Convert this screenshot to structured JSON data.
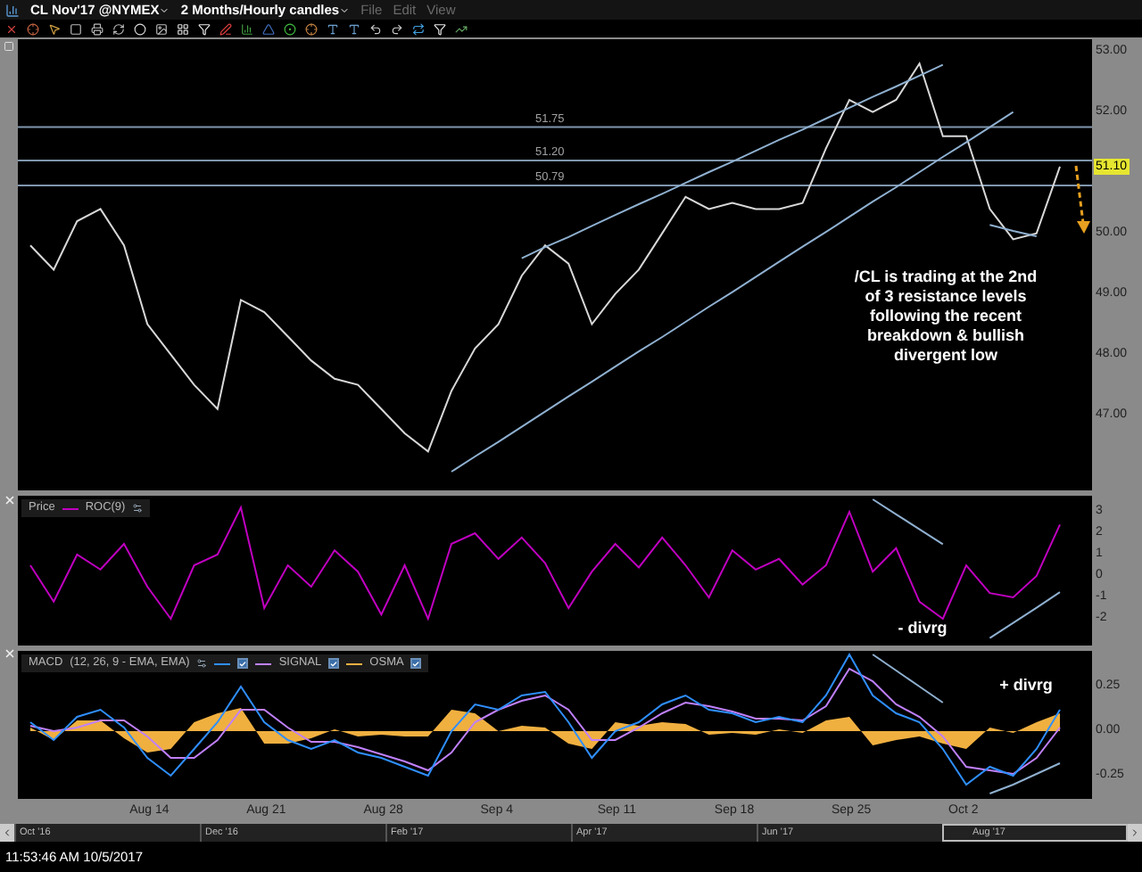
{
  "title_bar": {
    "symbol": "CL Nov'17 @NYMEX",
    "timeframe": "2 Months/Hourly candles",
    "menus": [
      {
        "label": "File",
        "disabled": true
      },
      {
        "label": "Edit",
        "disabled": true
      },
      {
        "label": "View",
        "disabled": true
      }
    ]
  },
  "price_panel": {
    "note": "/CL is trading at the 2nd of 3 resistance levels following the recent breakdown & bullish divergent low",
    "price_tag": "51.10",
    "chart_data": {
      "type": "line",
      "categories": [
        null,
        null,
        null,
        null,
        null,
        null,
        null,
        null,
        null,
        null,
        null,
        null,
        null,
        null,
        null,
        null,
        null,
        null,
        null,
        null,
        null,
        null,
        null,
        null,
        null,
        null,
        null,
        null,
        null,
        null,
        null,
        null,
        null,
        null,
        null,
        null,
        null,
        null,
        null,
        null,
        null,
        null,
        null,
        null,
        null
      ],
      "series": [
        {
          "color": "#d8d8d8",
          "values": [
            49.8,
            49.4,
            50.2,
            50.4,
            49.8,
            48.5,
            48.0,
            47.5,
            47.1,
            48.9,
            48.7,
            48.3,
            47.9,
            47.6,
            47.5,
            47.1,
            46.7,
            46.4,
            47.4,
            48.1,
            48.5,
            49.3,
            49.8,
            49.5,
            48.5,
            49.0,
            49.4,
            50.0,
            50.6,
            50.4,
            50.5,
            50.4,
            50.4,
            50.5,
            51.4,
            52.2,
            52.0,
            52.2,
            52.8,
            51.6,
            51.6,
            50.4,
            49.9,
            50.0,
            51.1
          ]
        },
        {
          "color": "#8fb0d0",
          "values": [
            null,
            null,
            null,
            null,
            null,
            null,
            null,
            null,
            null,
            null,
            null,
            null,
            null,
            null,
            null,
            null,
            null,
            null,
            null,
            null,
            null,
            49.59,
            49.77,
            49.94,
            50.12,
            50.3,
            50.48,
            50.65,
            50.83,
            51.01,
            51.18,
            51.36,
            51.54,
            51.71,
            51.89,
            52.07,
            52.25,
            52.42,
            52.6,
            52.78,
            null,
            null,
            null,
            null,
            null
          ]
        },
        {
          "color": "#8fb0d0",
          "values": [
            null,
            null,
            null,
            null,
            null,
            null,
            null,
            null,
            null,
            null,
            null,
            null,
            null,
            null,
            null,
            null,
            null,
            null,
            46.07,
            46.32,
            46.56,
            46.81,
            47.06,
            47.31,
            47.55,
            47.8,
            48.05,
            48.29,
            48.54,
            48.79,
            49.03,
            49.28,
            49.53,
            49.78,
            50.02,
            50.27,
            50.52,
            50.76,
            51.01,
            51.26,
            51.5,
            51.75,
            52.0,
            null,
            null
          ]
        },
        {
          "color": "#8fb0d0",
          "values": [
            null,
            null,
            null,
            null,
            null,
            null,
            null,
            null,
            null,
            null,
            null,
            null,
            null,
            null,
            null,
            null,
            null,
            null,
            null,
            null,
            null,
            null,
            null,
            null,
            null,
            null,
            null,
            null,
            null,
            null,
            null,
            null,
            null,
            null,
            null,
            null,
            null,
            null,
            null,
            null,
            null,
            50.14,
            50.04,
            49.95,
            null
          ]
        }
      ],
      "ref_lines": [
        {
          "axis": "y",
          "value": 51.75,
          "label": "51.75"
        },
        {
          "axis": "y",
          "value": 51.2,
          "label": "51.20"
        },
        {
          "axis": "y",
          "value": 50.79,
          "label": "50.79"
        }
      ],
      "ylim": [
        45.76,
        53.2
      ],
      "yticks": [
        {
          "value": 53,
          "label": "53.00"
        },
        {
          "value": 52,
          "label": "52.00"
        },
        {
          "value": 50,
          "label": "50.00"
        },
        {
          "value": 49,
          "label": "49.00"
        },
        {
          "value": 48,
          "label": "48.00"
        },
        {
          "value": 47,
          "label": "47.00"
        }
      ]
    }
  },
  "roc_panel": {
    "legend": {
      "kind": "overlay",
      "prefix": "Price"
    },
    "note": "- divrg",
    "chart_data": {
      "type": "line",
      "legend": "upper left",
      "categories": [
        null,
        null,
        null,
        null,
        null,
        null,
        null,
        null,
        null,
        null,
        null,
        null,
        null,
        null,
        null,
        null,
        null,
        null,
        null,
        null,
        null,
        null,
        null,
        null,
        null,
        null,
        null,
        null,
        null,
        null,
        null,
        null,
        null,
        null,
        null,
        null,
        null,
        null,
        null,
        null,
        null,
        null,
        null,
        null,
        null
      ],
      "series": [
        {
          "name": "ROC(9)",
          "color": "#c000c0",
          "values": [
            0.5,
            -1.2,
            1.0,
            0.3,
            1.5,
            -0.5,
            -2.0,
            0.5,
            1.0,
            3.2,
            -1.5,
            0.5,
            -0.5,
            1.2,
            0.2,
            -1.8,
            0.5,
            -2.0,
            1.5,
            2.0,
            0.8,
            1.8,
            0.6,
            -1.5,
            0.2,
            1.5,
            0.4,
            1.8,
            0.5,
            -1.0,
            1.2,
            0.3,
            0.8,
            -0.4,
            0.5,
            3.0,
            0.2,
            1.3,
            -1.2,
            -2.0,
            0.5,
            -0.8,
            -1.0,
            0.0,
            2.4
          ]
        },
        {
          "color": "#8fb0d0",
          "values": [
            null,
            null,
            null,
            null,
            null,
            null,
            null,
            null,
            null,
            null,
            null,
            null,
            null,
            null,
            null,
            null,
            null,
            null,
            null,
            null,
            null,
            null,
            null,
            null,
            null,
            null,
            null,
            null,
            null,
            null,
            null,
            null,
            null,
            null,
            null,
            null,
            3.58,
            2.88,
            2.18,
            1.48,
            null,
            null,
            null,
            null,
            null
          ]
        },
        {
          "color": "#8fb0d0",
          "values": [
            null,
            null,
            null,
            null,
            null,
            null,
            null,
            null,
            null,
            null,
            null,
            null,
            null,
            null,
            null,
            null,
            null,
            null,
            null,
            null,
            null,
            null,
            null,
            null,
            null,
            null,
            null,
            null,
            null,
            null,
            null,
            null,
            null,
            null,
            null,
            null,
            null,
            null,
            null,
            null,
            null,
            -2.9,
            -2.19,
            -1.48,
            -0.76
          ]
        }
      ],
      "ylim": [
        -3.25,
        3.75
      ],
      "yticks": [
        {
          "value": 3,
          "label": "3"
        },
        {
          "value": 2,
          "label": "2"
        },
        {
          "value": 1,
          "label": "1"
        },
        {
          "value": 0,
          "label": "0"
        },
        {
          "value": -1,
          "label": "-1"
        },
        {
          "value": -2,
          "label": "-2"
        }
      ]
    }
  },
  "macd_panel": {
    "legend": {
      "kind": "macd",
      "title": "MACD",
      "params": "(12, 26, 9 - EMA, EMA)",
      "checks": [
        {
          "checked": true
        },
        {
          "checked": true
        },
        {
          "checked": true
        }
      ]
    },
    "note": "+ divrg",
    "chart_data": {
      "type": "line",
      "legend": "upper left",
      "categories": [
        null,
        null,
        null,
        null,
        null,
        "Aug 14",
        null,
        null,
        null,
        null,
        "Aug 21",
        null,
        null,
        null,
        null,
        "Aug 28",
        null,
        null,
        null,
        null,
        "Sep 4",
        null,
        null,
        null,
        null,
        "Sep 11",
        null,
        null,
        null,
        null,
        "Sep 18",
        null,
        null,
        null,
        null,
        "Sep 25",
        null,
        null,
        null,
        null,
        "Oct 2",
        null,
        null,
        null,
        null
      ],
      "series": [
        {
          "name": "OSMA",
          "type": "area",
          "color": "#f0b040",
          "values": [
            0.02,
            -0.05,
            0.06,
            0.06,
            -0.04,
            -0.12,
            -0.1,
            0.05,
            0.1,
            0.13,
            -0.07,
            -0.07,
            -0.04,
            0.01,
            -0.03,
            -0.02,
            -0.03,
            -0.03,
            0.12,
            0.1,
            0.0,
            0.03,
            0.02,
            -0.07,
            -0.1,
            0.05,
            0.03,
            0.05,
            0.04,
            -0.02,
            -0.01,
            -0.02,
            0.01,
            -0.01,
            0.06,
            0.08,
            -0.08,
            -0.05,
            -0.03,
            -0.07,
            -0.1,
            0.02,
            -0.01,
            0.05,
            0.1
          ]
        },
        {
          "name": "SIGNAL",
          "color": "#c080ff",
          "values": [
            0.03,
            0.0,
            0.02,
            0.06,
            0.06,
            -0.03,
            -0.15,
            -0.15,
            -0.05,
            0.12,
            0.12,
            0.02,
            -0.06,
            -0.06,
            -0.09,
            -0.13,
            -0.17,
            -0.22,
            -0.12,
            0.05,
            0.12,
            0.17,
            0.2,
            0.12,
            -0.05,
            -0.05,
            0.02,
            0.1,
            0.16,
            0.14,
            0.11,
            0.07,
            0.07,
            0.06,
            0.14,
            0.35,
            0.28,
            0.15,
            0.08,
            -0.03,
            -0.2,
            -0.22,
            -0.24,
            -0.15,
            0.02
          ]
        },
        {
          "color": "#2f8fff",
          "values": [
            0.05,
            -0.05,
            0.08,
            0.12,
            0.02,
            -0.15,
            -0.25,
            -0.1,
            0.05,
            0.25,
            0.05,
            -0.05,
            -0.1,
            -0.05,
            -0.12,
            -0.15,
            -0.2,
            -0.25,
            0.0,
            0.15,
            0.12,
            0.2,
            0.22,
            0.05,
            -0.15,
            0.0,
            0.05,
            0.15,
            0.2,
            0.12,
            0.1,
            0.05,
            0.08,
            0.05,
            0.2,
            0.43,
            0.2,
            0.1,
            0.05,
            -0.1,
            -0.3,
            -0.2,
            -0.25,
            -0.1,
            0.12
          ]
        },
        {
          "color": "#8fb0d0",
          "values": [
            null,
            null,
            null,
            null,
            null,
            null,
            null,
            null,
            null,
            null,
            null,
            null,
            null,
            null,
            null,
            null,
            null,
            null,
            null,
            null,
            null,
            null,
            null,
            null,
            null,
            null,
            null,
            null,
            null,
            null,
            null,
            null,
            null,
            null,
            null,
            null,
            0.43,
            0.34,
            0.25,
            0.16,
            null,
            null,
            null,
            null,
            null
          ]
        },
        {
          "color": "#8fb0d0",
          "values": [
            null,
            null,
            null,
            null,
            null,
            null,
            null,
            null,
            null,
            null,
            null,
            null,
            null,
            null,
            null,
            null,
            null,
            null,
            null,
            null,
            null,
            null,
            null,
            null,
            null,
            null,
            null,
            null,
            null,
            null,
            null,
            null,
            null,
            null,
            null,
            null,
            null,
            null,
            null,
            null,
            null,
            -0.35,
            -0.3,
            -0.24,
            -0.18
          ]
        }
      ],
      "ylim": [
        -0.38,
        0.45
      ],
      "yticks": [
        {
          "value": 0.25,
          "label": "0.25"
        },
        {
          "value": 0,
          "label": "0.00"
        },
        {
          "value": -0.25,
          "label": "-0.25"
        }
      ]
    }
  },
  "scrollbar": {
    "labels": [
      "Oct '16",
      "Dec '16",
      "Feb '17",
      "Apr '17",
      "Jun '17",
      "Aug '17"
    ]
  },
  "status_bar": {
    "text": "11:53:46 AM 10/5/2017"
  }
}
